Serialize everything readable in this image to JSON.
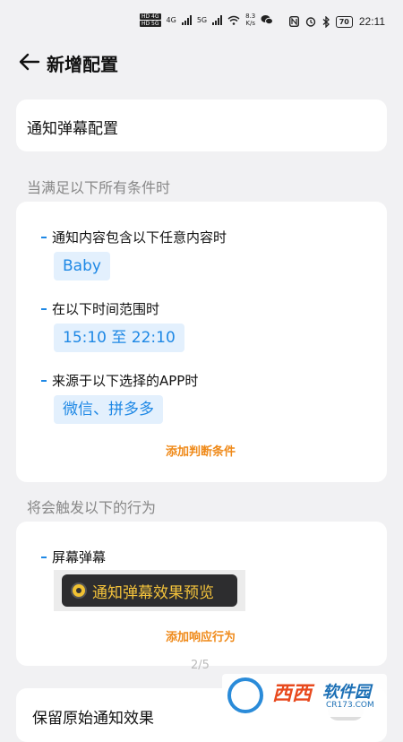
{
  "status_bar": {
    "hd1": "HD 4G",
    "hd2": "HD 5G",
    "net_label_1": "4G",
    "net_label_2": "5G",
    "speed_value": "8.3",
    "speed_unit": "K/s",
    "battery": "70",
    "time": "22:11"
  },
  "header": {
    "title": "新增配置"
  },
  "config_card": {
    "title": "通知弹幕配置"
  },
  "conditions": {
    "section_label": "当满足以下所有条件时",
    "items": [
      {
        "title": "通知内容包含以下任意内容时",
        "value": "Baby"
      },
      {
        "title": "在以下时间范围时",
        "value": "15:10 至 22:10"
      },
      {
        "title": "来源于以下选择的APP时",
        "value": "微信、拼多多"
      }
    ],
    "add_label": "添加判断条件"
  },
  "actions": {
    "section_label": "将会触发以下的行为",
    "item_title": "屏幕弹幕",
    "preview_text": "通知弹幕效果预览",
    "add_label": "添加响应行为"
  },
  "page_indicator": "2/5",
  "keep_original": {
    "label": "保留原始通知效果"
  },
  "watermark": {
    "text1": "西西",
    "text2": "软件园",
    "url": "CR173.COM"
  },
  "colors": {
    "accent": "#1e88e5",
    "link": "#ef8a1a",
    "preview_text": "#f3c23b"
  }
}
